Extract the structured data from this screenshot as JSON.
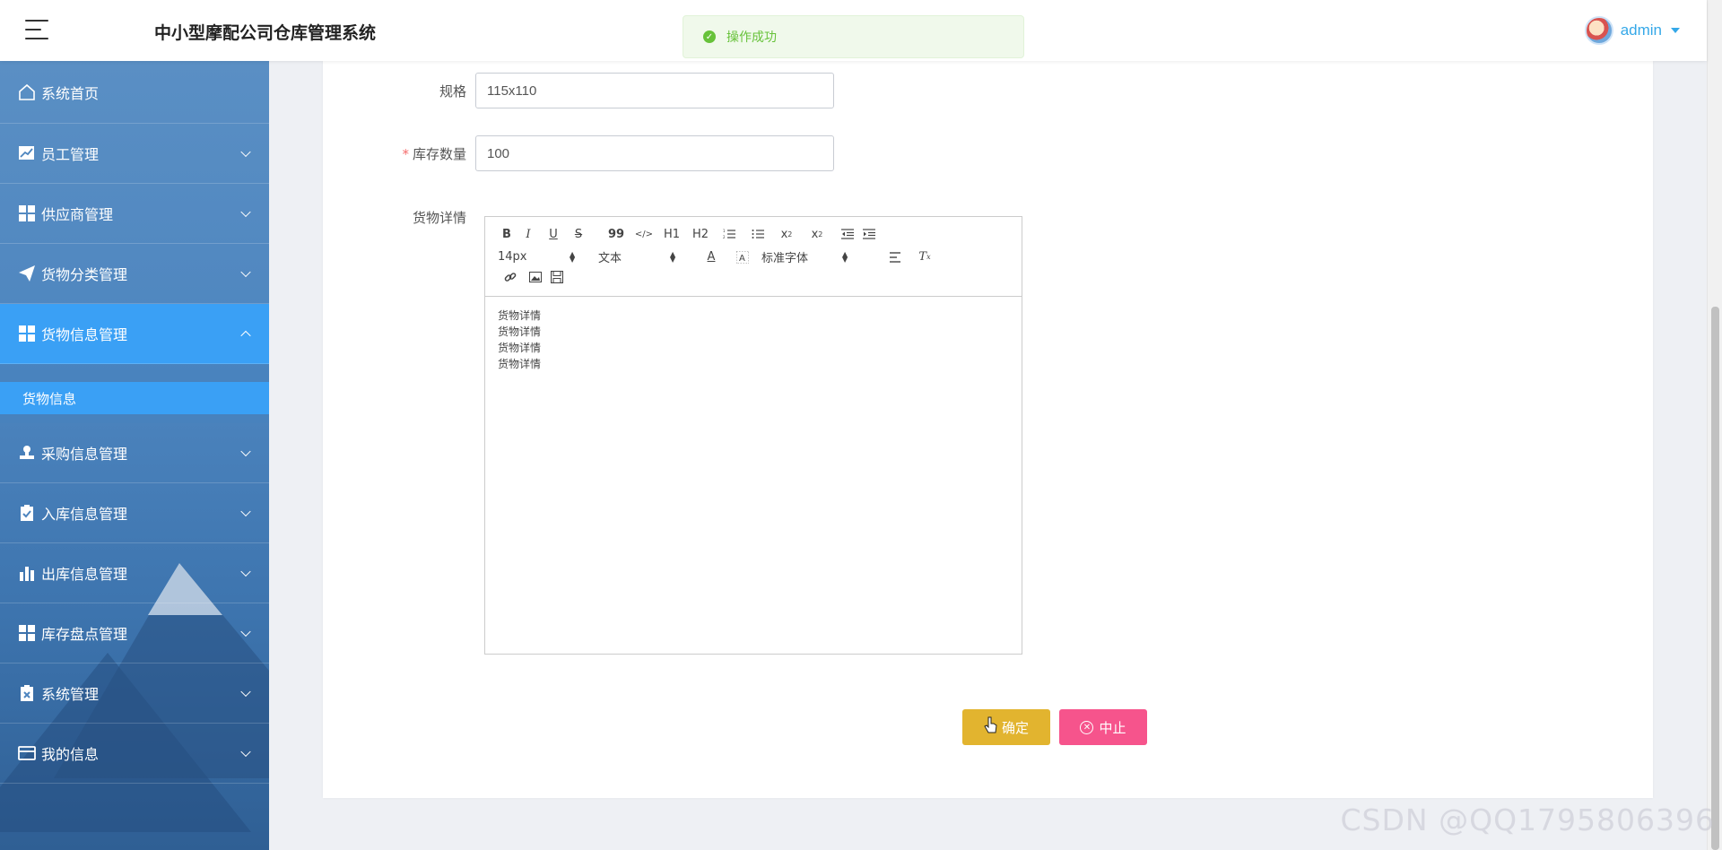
{
  "header": {
    "app_title": "中小型摩配公司仓库管理系统",
    "user_name": "admin"
  },
  "toast": {
    "message": "操作成功"
  },
  "sidebar": {
    "items": [
      {
        "label": "系统首页",
        "icon": "home-icon"
      },
      {
        "label": "员工管理",
        "icon": "chart-line-icon"
      },
      {
        "label": "供应商管理",
        "icon": "grid-icon"
      },
      {
        "label": "货物分类管理",
        "icon": "send-icon"
      },
      {
        "label": "货物信息管理",
        "icon": "grid-icon",
        "expanded": true,
        "sub_items": [
          "货物信息"
        ]
      },
      {
        "label": "采购信息管理",
        "icon": "stamp-icon"
      },
      {
        "label": "入库信息管理",
        "icon": "clipboard-check-icon"
      },
      {
        "label": "出库信息管理",
        "icon": "bar-chart-icon"
      },
      {
        "label": "库存盘点管理",
        "icon": "grid-icon"
      },
      {
        "label": "系统管理",
        "icon": "clipboard-x-icon"
      },
      {
        "label": "我的信息",
        "icon": "wallet-icon"
      }
    ]
  },
  "form": {
    "spec": {
      "label": "规格",
      "value": "115x110"
    },
    "stock": {
      "label": "库存数量",
      "value": "100",
      "required_mark": "*"
    },
    "detail": {
      "label": "货物详情",
      "content_lines": [
        "货物详情",
        "货物详情",
        "货物详情",
        "货物详情"
      ]
    }
  },
  "editor_toolbar": {
    "bold": "B",
    "italic": "I",
    "underline": "U",
    "strike": "S",
    "blockquote": "99",
    "code": "</>",
    "h1": "H1",
    "h2": "H2",
    "sub": "x2",
    "sup": "x2",
    "font_size": "14px",
    "header_select": "文本",
    "font_family": "标准字体",
    "clean": "Tx"
  },
  "buttons": {
    "confirm": "确定",
    "cancel": "中止"
  },
  "watermark": "CSDN @QQ1795806396",
  "colors": {
    "accent_blue": "#3aa0f5",
    "confirm_yellow": "#e2b42f",
    "cancel_pink": "#f6548c",
    "success_green": "#67c23a"
  }
}
